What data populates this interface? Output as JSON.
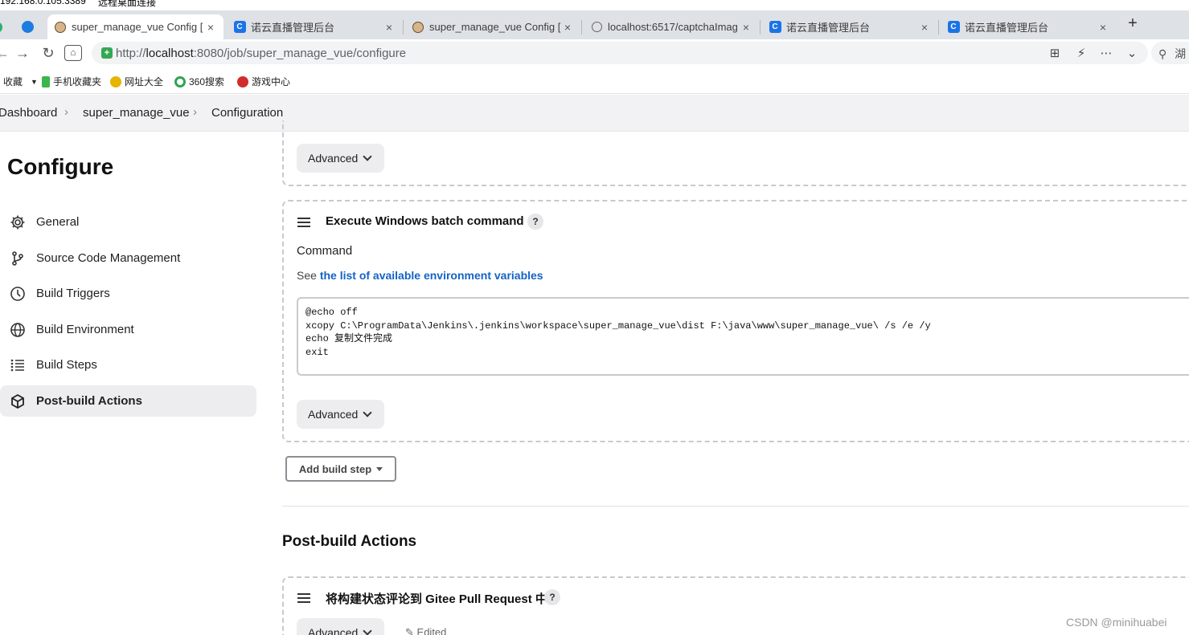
{
  "remote_strip": {
    "ip": "192.168.0.105:3389",
    "label": "远程桌面连接"
  },
  "tabs": [
    {
      "title": "super_manage_vue Config [",
      "icon": "jenkins-icon"
    },
    {
      "title": "诺云直播管理后台",
      "icon": "app-icon"
    },
    {
      "title": "super_manage_vue Config [",
      "icon": "jenkins-icon"
    },
    {
      "title": "localhost:6517/captchaImag",
      "icon": "globe-icon"
    },
    {
      "title": "诺云直播管理后台",
      "icon": "app-icon"
    },
    {
      "title": "诺云直播管理后台",
      "icon": "app-icon"
    }
  ],
  "address": {
    "prefix": "http://",
    "host": "localhost",
    "rest": ":8080/job/super_manage_vue/configure"
  },
  "search_label": "湖",
  "bookmarks": [
    {
      "label": "收藏",
      "icon": "star-icon"
    },
    {
      "label": "手机收藏夹",
      "icon": "phone-icon"
    },
    {
      "label": "网址大全",
      "icon": "sites-icon"
    },
    {
      "label": "360搜索",
      "icon": "search-360-icon"
    },
    {
      "label": "游戏中心",
      "icon": "game-icon"
    }
  ],
  "breadcrumb": [
    "Dashboard",
    "super_manage_vue",
    "Configuration"
  ],
  "page_title": "Configure",
  "sidebar": [
    {
      "label": "General",
      "icon": "gear-icon"
    },
    {
      "label": "Source Code Management",
      "icon": "branch-icon"
    },
    {
      "label": "Build Triggers",
      "icon": "clock-icon"
    },
    {
      "label": "Build Environment",
      "icon": "globe-icon"
    },
    {
      "label": "Build Steps",
      "icon": "list-icon"
    },
    {
      "label": "Post-build Actions",
      "icon": "cube-icon",
      "active": true
    }
  ],
  "advanced_label": "Advanced",
  "batch_step": {
    "title": "Execute Windows batch command",
    "command_label": "Command",
    "see_prefix": "See",
    "see_link": "the list of available environment variables",
    "command": "@echo off\nxcopy C:\\ProgramData\\Jenkins\\.jenkins\\workspace\\super_manage_vue\\dist F:\\java\\www\\super_manage_vue\\ /s /e /y\necho 复制文件完成\nexit"
  },
  "add_build_step": "Add build step",
  "post_build": {
    "heading": "Post-build Actions",
    "action_title": "将构建状态评论到 Gitee Pull Request 中",
    "edited": "Edited"
  },
  "watermark": "CSDN @minihuabei"
}
